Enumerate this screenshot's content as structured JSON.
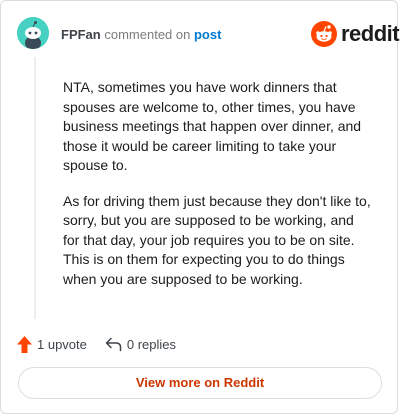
{
  "header": {
    "username": "FPFan",
    "commented_text": "commented on",
    "post_link": "post",
    "brand_word": "reddit"
  },
  "comment": {
    "paragraphs": [
      "NTA, sometimes you have work dinners that spouses are welcome to, other times, you have business meetings that happen over dinner, and those it would be career limiting to take your spouse to.",
      "As for driving them just because they don't like to, sorry, but you are supposed to be working, and for that day, your job requires you to be on site. This is on them for expecting you to do things when you are supposed to be working."
    ]
  },
  "actions": {
    "upvote_label": "1 upvote",
    "replies_label": "0 replies"
  },
  "footer": {
    "view_more_label": "View more on Reddit"
  },
  "colors": {
    "brand_orange": "#ff4500",
    "upvote_orange": "#ff4500",
    "avatar_teal": "#46d1c3",
    "link_blue": "#0079d3",
    "view_more_text": "#cc3700"
  },
  "icons": {
    "avatar": "snoo-avatar",
    "brand": "reddit-logo-icon",
    "upvote": "upvote-arrow-icon",
    "reply": "reply-arrow-icon"
  }
}
